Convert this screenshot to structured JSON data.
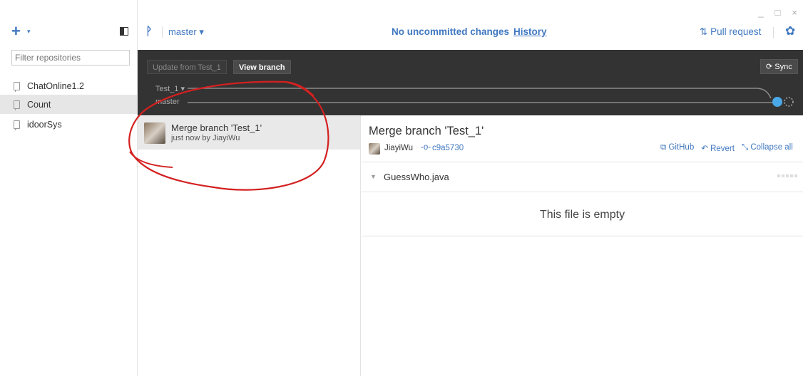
{
  "window": {
    "minimize": "_",
    "maximize": "□",
    "close": "×"
  },
  "sidebar": {
    "add": "+",
    "add_caret": "▾",
    "filter_placeholder": "Filter repositories",
    "repos": [
      "ChatOnline1.2",
      "Count",
      "idoorSys"
    ],
    "selected_repo": "Count"
  },
  "topbar": {
    "branch_icon": "ᚹ",
    "branch": "master ▾",
    "status": "No uncommitted changes",
    "history": "History",
    "pull_request": "Pull request",
    "gear": "✿"
  },
  "branchbar": {
    "update_button": "Update from Test_1",
    "view_button": "View branch",
    "sync_button": "Sync",
    "lane_branch": "Test_1 ▾",
    "lane_master": "master"
  },
  "commits": [
    {
      "title": "Merge branch 'Test_1'",
      "subtitle": "just now by JiayiWu"
    }
  ],
  "detail": {
    "title": "Merge branch 'Test_1'",
    "author": "JiayiWu",
    "sha": "c9a5730",
    "actions": {
      "github": "GitHub",
      "revert": "Revert",
      "collapse": "Collapse all"
    },
    "file": "GuessWho.java",
    "empty_message": "This file is empty"
  },
  "colors": {
    "accent": "#4078c0",
    "dark_bar": "#333333",
    "annotation": "#d42020",
    "graph_node": "#4aa8e8"
  }
}
